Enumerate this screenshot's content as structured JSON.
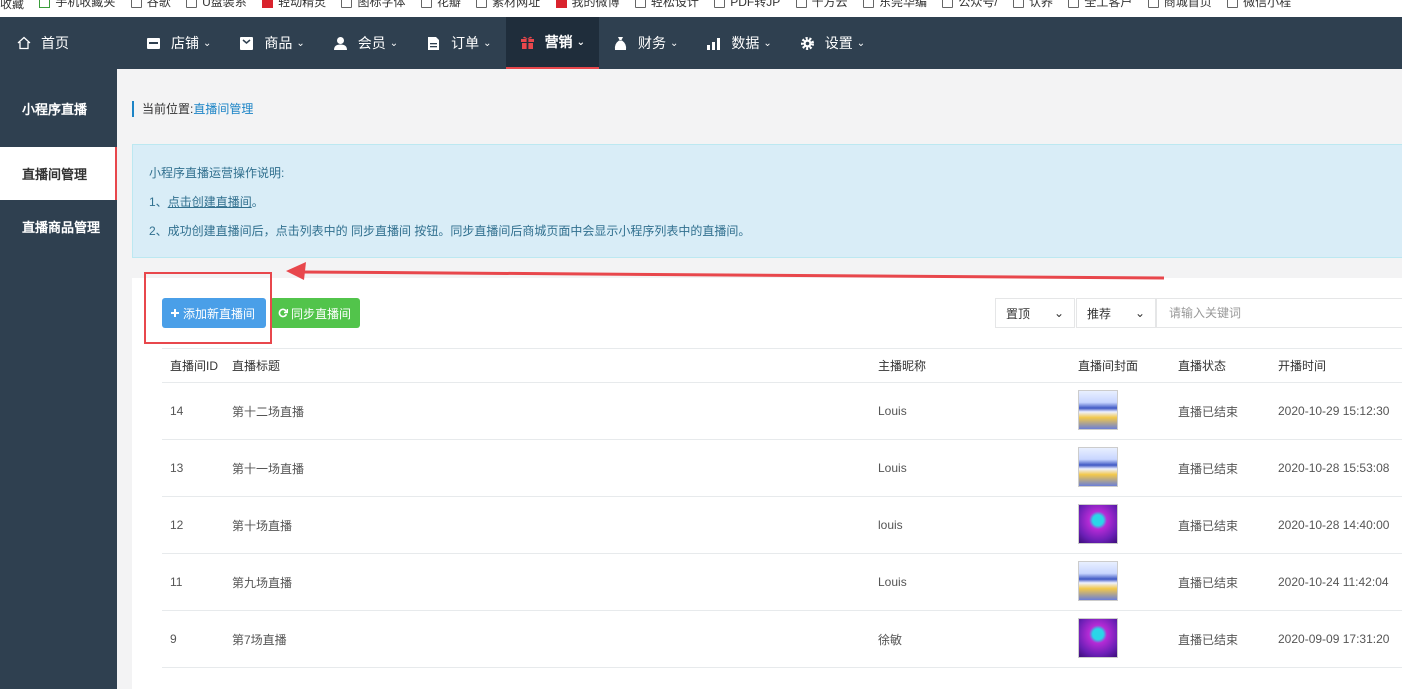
{
  "bookmarks": [
    {
      "label": "收藏",
      "icon": "star-icon"
    },
    {
      "label": "手机收藏夹",
      "icon": "phone-icon"
    },
    {
      "label": "谷歌",
      "icon": "page-icon"
    },
    {
      "label": "U盘装系",
      "icon": "page-icon"
    },
    {
      "label": "轻动精灵",
      "icon": "app-icon"
    },
    {
      "label": "图标字体",
      "icon": "page-icon"
    },
    {
      "label": "花瓣",
      "icon": "page-icon"
    },
    {
      "label": "素材网址",
      "icon": "page-icon"
    },
    {
      "label": "我的微博",
      "icon": "weibo-icon"
    },
    {
      "label": "轻松设计",
      "icon": "page-icon"
    },
    {
      "label": "PDF转JP",
      "icon": "page-icon"
    },
    {
      "label": "千方云",
      "icon": "page-icon"
    },
    {
      "label": "东莞华编",
      "icon": "page-icon"
    },
    {
      "label": "公众号/",
      "icon": "page-icon"
    },
    {
      "label": "认养",
      "icon": "page-icon"
    },
    {
      "label": "全工客户",
      "icon": "page-icon"
    },
    {
      "label": "商城首页",
      "icon": "page-icon"
    },
    {
      "label": "微信小程",
      "icon": "page-icon"
    }
  ],
  "nav": {
    "home": "首页",
    "items": [
      {
        "label": "店铺",
        "icon": "store-icon"
      },
      {
        "label": "商品",
        "icon": "goods-icon"
      },
      {
        "label": "会员",
        "icon": "user-icon"
      },
      {
        "label": "订单",
        "icon": "order-icon"
      },
      {
        "label": "营销",
        "icon": "gift-icon",
        "active": true
      },
      {
        "label": "财务",
        "icon": "money-bag-icon"
      },
      {
        "label": "数据",
        "icon": "chart-icon"
      },
      {
        "label": "设置",
        "icon": "gear-icon"
      }
    ],
    "active_color": "#e8474c"
  },
  "sidebar": {
    "items": [
      {
        "label": "小程序直播"
      },
      {
        "label": "直播间管理",
        "active": true
      },
      {
        "label": "直播商品管理"
      }
    ]
  },
  "breadcrumb": {
    "prefix": "当前位置:",
    "current": "直播间管理"
  },
  "notice": {
    "title": "小程序直播运营操作说明:",
    "line1_prefix": "1、",
    "line1_link": "点击创建直播间",
    "line1_suffix": "。",
    "line2": "2、成功创建直播间后，点击列表中的 同步直播间 按钮。同步直播间后商城页面中会显示小程序列表中的直播间。"
  },
  "toolbar": {
    "add_label": "添加新直播间",
    "sync_label": "同步直播间",
    "filter1": "置顶",
    "filter2": "推荐",
    "search_placeholder": "请输入关键词"
  },
  "table": {
    "headers": [
      "直播间ID",
      "直播标题",
      "主播昵称",
      "直播间封面",
      "直播状态",
      "开播时间"
    ],
    "rows": [
      {
        "id": "14",
        "title": "第十二场直播",
        "anchor": "Louis",
        "cover": "blue",
        "status": "直播已结束",
        "time": "2020-10-29 15:12:30"
      },
      {
        "id": "13",
        "title": "第十一场直播",
        "anchor": "Louis",
        "cover": "blue",
        "status": "直播已结束",
        "time": "2020-10-28 15:53:08"
      },
      {
        "id": "12",
        "title": "第十场直播",
        "anchor": "louis",
        "cover": "purple",
        "status": "直播已结束",
        "time": "2020-10-28 14:40:00"
      },
      {
        "id": "11",
        "title": "第九场直播",
        "anchor": "Louis",
        "cover": "blue",
        "status": "直播已结束",
        "time": "2020-10-24 11:42:04"
      },
      {
        "id": "9",
        "title": "第7场直播",
        "anchor": "徐敏",
        "cover": "purple",
        "status": "直播已结束",
        "time": "2020-09-09 17:31:20"
      }
    ]
  },
  "annotation_color": "#e8474c"
}
